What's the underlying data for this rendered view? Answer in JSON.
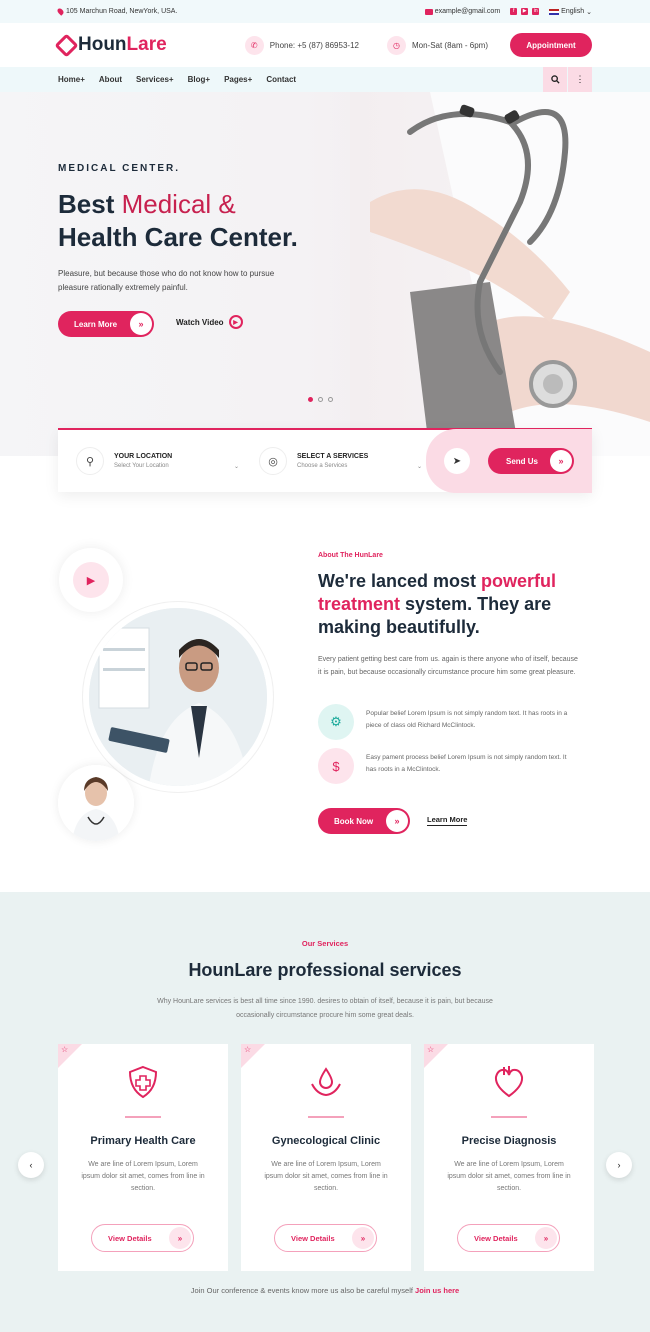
{
  "topbar": {
    "address": "105 Marchun Road, NewYork, USA.",
    "email": "example@gmail.com",
    "language": "English"
  },
  "header": {
    "logo_main": "Houn",
    "logo_accent": "Lare",
    "phone": "Phone: +5 (87) 86953-12",
    "hours": "Mon-Sat (8am - 6pm)",
    "appointment": "Appointment"
  },
  "nav": {
    "items": [
      "Home+",
      "About",
      "Services+",
      "Blog+",
      "Pages+",
      "Contact"
    ]
  },
  "hero": {
    "kicker": "MEDICAL CENTER.",
    "title_part1": "Best",
    "title_accent": "Medical &",
    "title_part2": "Health Care Center.",
    "subtitle": "Pleasure, but because those who do not know how to pursue pleasure rationally extremely painful.",
    "learn_more": "Learn More",
    "watch_video": "Watch Video",
    "slide_active": 1
  },
  "search": {
    "location_title": "YOUR LOCATION",
    "location_placeholder": "Select Your Location",
    "service_title": "SELECT A SERVICES",
    "service_placeholder": "Choose a Services",
    "send": "Send Us"
  },
  "about": {
    "kicker": "About The HunLare",
    "title_a": "We're lanced most",
    "title_b": "powerful",
    "title_c": "treatment",
    "title_d": "system. They are making beautifully.",
    "paragraph": "Every patient getting best care from us. again is there anyone who of itself, because it is pain, but because occasionally circumstance procure him some great pleasure.",
    "feature1": "Popular belief Lorem Ipsum is not simply random text. It has roots in a piece of class old Richard McClintock.",
    "feature2": "Easy pament process belief Lorem Ipsum is not simply random text. It has roots in a McClintock.",
    "book": "Book Now",
    "learn": "Learn More"
  },
  "services": {
    "kicker": "Our Services",
    "title": "HounLare professional services",
    "intro": "Why HounLare services is best all time since 1990. desires to obtain of itself, because it is pain, but because occasionally circumstance procure him some great deals.",
    "cards": [
      {
        "title": "Primary Health Care",
        "text": "We are line of Lorem Ipsum, Lorem ipsum dolor sit amet, comes from line in section.",
        "button": "View Details",
        "icon": "shield-cross-icon"
      },
      {
        "title": "Gynecological Clinic",
        "text": "We are line of Lorem Ipsum, Lorem ipsum dolor sit amet, comes from line in section.",
        "button": "View Details",
        "icon": "hand-drop-icon"
      },
      {
        "title": "Precise Diagnosis",
        "text": "We are line of Lorem Ipsum, Lorem ipsum dolor sit amet, comes from line in section.",
        "button": "View Details",
        "icon": "heart-icon"
      }
    ],
    "footer_text": "Join Our conference & events know more us also be careful myself",
    "footer_link": "Join us here"
  },
  "colors": {
    "accent": "#e0245e",
    "dark": "#1d2b3a",
    "soft_pink": "#fbdbe5",
    "light_bg": "#eaf2f2"
  }
}
